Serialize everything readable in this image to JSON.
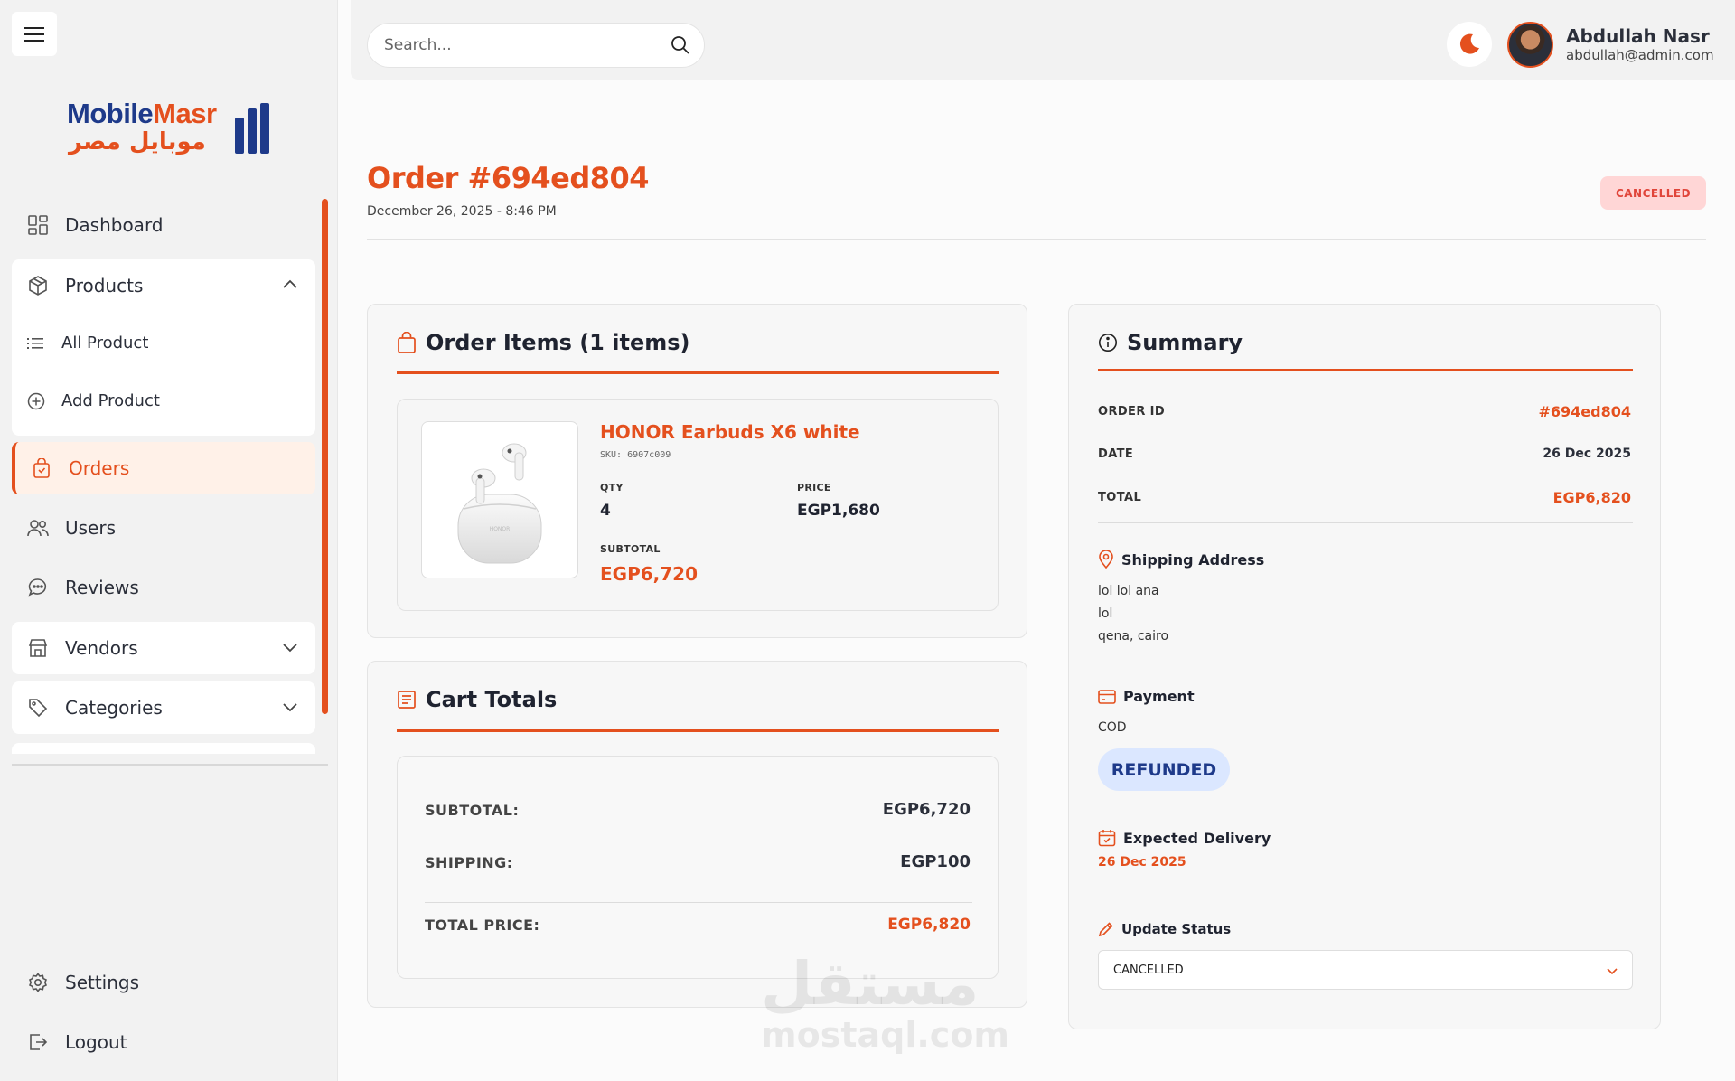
{
  "sidebar": {
    "logo": {
      "en_a": "Mobile",
      "en_b": "Masr",
      "ar": "موبايل مصر"
    },
    "items": {
      "dashboard": "Dashboard",
      "products": "Products",
      "all_product": "All Product",
      "add_product": "Add Product",
      "orders": "Orders",
      "users": "Users",
      "reviews": "Reviews",
      "vendors": "Vendors",
      "categories": "Categories",
      "settings": "Settings",
      "logout": "Logout"
    }
  },
  "topbar": {
    "search_placeholder": "Search...",
    "user_name": "Abdullah Nasr",
    "user_email": "abdullah@admin.com"
  },
  "order": {
    "title": "Order #694ed804",
    "date": "December 26, 2025 - 8:46 PM",
    "status": "CANCELLED"
  },
  "items_card": {
    "title": "Order Items (1 items)",
    "product": {
      "name": "HONOR Earbuds X6 white",
      "sku": "SKU: 6907c009",
      "qty_label": "QTY",
      "qty": "4",
      "price_label": "PRICE",
      "price": "EGP1,680",
      "subtotal_label": "SUBTOTAL",
      "subtotal": "EGP6,720",
      "case_text": "HONOR"
    }
  },
  "totals_card": {
    "title": "Cart Totals",
    "subtotal_label": "SUBTOTAL:",
    "subtotal": "EGP6,720",
    "shipping_label": "SHIPPING:",
    "shipping": "EGP100",
    "total_label": "TOTAL PRICE:",
    "total": "EGP6,820"
  },
  "summary": {
    "title": "Summary",
    "order_id_label": "ORDER ID",
    "order_id": "#694ed804",
    "date_label": "DATE",
    "date": "26 Dec 2025",
    "total_label": "TOTAL",
    "total": "EGP6,820",
    "shipping_title": "Shipping Address",
    "address_line1": "lol lol ana",
    "address_line2": "lol",
    "address_line3": "qena, cairo",
    "payment_title": "Payment",
    "payment_method": "COD",
    "payment_status": "REFUNDED",
    "delivery_title": "Expected Delivery",
    "delivery_date": "26 Dec 2025",
    "update_title": "Update Status",
    "update_value": "CANCELLED"
  },
  "watermark": {
    "ar": "مستقل",
    "en": "mostaql.com"
  },
  "colors": {
    "accent": "#e4501e",
    "brand_blue": "#1e3a8a",
    "danger_bg": "#ffd6d6",
    "refund_bg": "#dbe7ff"
  }
}
